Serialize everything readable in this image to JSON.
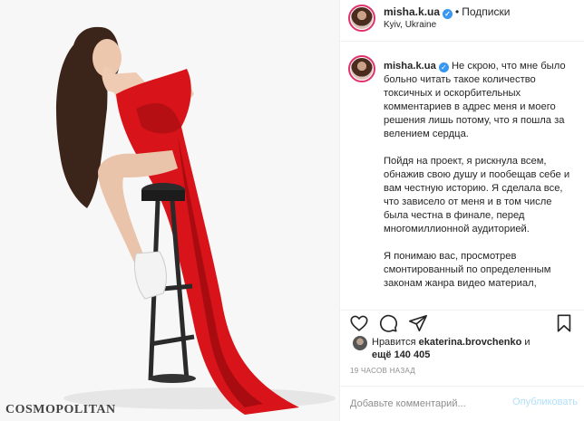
{
  "photo": {
    "watermark": "COSMOPOLITAN",
    "alt": "Woman in red satin dress sitting on a bar stool"
  },
  "header": {
    "username": "misha.k.ua",
    "verified_icon": "verified-badge-icon",
    "separator": "•",
    "follow_label": "Подписки",
    "location": "Kyiv, Ukraine"
  },
  "caption": {
    "username": "misha.k.ua",
    "paragraphs": [
      "Не скрою, что мне было больно читать такое количество токсичных и оскорбительных комментариев в адрес меня и моего решения лишь потому, что я пошла за велением сердца.",
      "Пойдя на проект, я рискнула всем, обнажив свою душу и пообещав себе и вам честную историю. Я сделала все, что зависело от меня и в том числе была честна в финале, перед многомиллионной аудиторией.",
      "Я понимаю вас, просмотрев смонтированный по определенным законам жанра видео материал,"
    ]
  },
  "actions": {
    "icons": [
      "heart-icon",
      "comment-icon",
      "share-icon",
      "bookmark-icon"
    ]
  },
  "likes": {
    "prefix": "Нравится",
    "liker": "ekaterina.brovchenko",
    "conjunction": "и",
    "more_count": "ещё 140 405"
  },
  "timestamp": "19 часов назад",
  "comment_box": {
    "placeholder": "Добавьте комментарий...",
    "publish_label": "Опубликовать"
  },
  "colors": {
    "dress": "#d8141a",
    "verified": "#3897f0",
    "publish_disabled": "#b2dffc",
    "meta_text": "#8e8e8e"
  }
}
